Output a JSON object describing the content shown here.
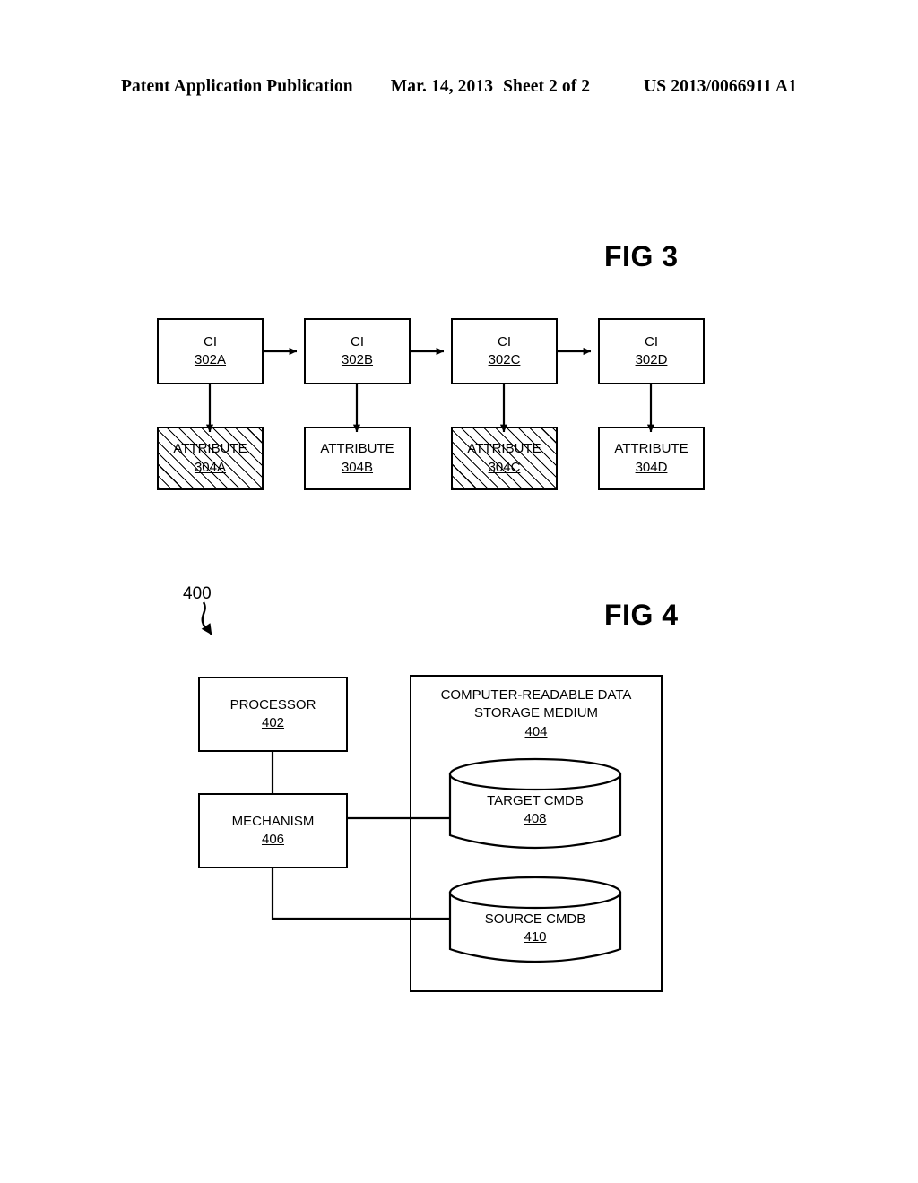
{
  "header": {
    "publication": "Patent Application Publication",
    "date": "Mar. 14, 2013",
    "sheet": "Sheet 2 of 2",
    "patent_number": "US 2013/0066911 A1"
  },
  "fig3": {
    "title": "FIG 3",
    "ci_nodes": [
      {
        "label": "CI",
        "ref": "302A"
      },
      {
        "label": "CI",
        "ref": "302B"
      },
      {
        "label": "CI",
        "ref": "302C"
      },
      {
        "label": "CI",
        "ref": "302D"
      }
    ],
    "attribute_nodes": [
      {
        "label": "ATTRIBUTE",
        "ref": "304A",
        "hatched": true
      },
      {
        "label": "ATTRIBUTE",
        "ref": "304B",
        "hatched": false
      },
      {
        "label": "ATTRIBUTE",
        "ref": "304C",
        "hatched": true
      },
      {
        "label": "ATTRIBUTE",
        "ref": "304D",
        "hatched": false
      }
    ]
  },
  "fig4": {
    "title": "FIG 4",
    "callout_ref": "400",
    "processor": {
      "label": "PROCESSOR",
      "ref": "402"
    },
    "mechanism": {
      "label": "MECHANISM",
      "ref": "406"
    },
    "storage_medium": {
      "label_line1": "COMPUTER-READABLE DATA",
      "label_line2": "STORAGE MEDIUM",
      "ref": "404"
    },
    "target_cmdb": {
      "label": "TARGET CMDB",
      "ref": "408"
    },
    "source_cmdb": {
      "label": "SOURCE CMDB",
      "ref": "410"
    }
  },
  "colors": {
    "ink": "#000000",
    "paper": "#ffffff"
  }
}
